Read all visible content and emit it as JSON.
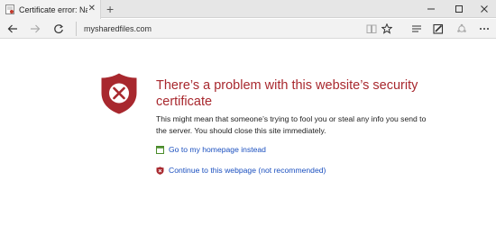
{
  "tab": {
    "title": "Certificate error: Naviga",
    "close_glyph": "✕",
    "new_tab_glyph": "+"
  },
  "window_controls": {
    "minimize_glyph": "—",
    "maximize_glyph": "☐",
    "close_glyph": "✕"
  },
  "address_bar": {
    "url": "mysharedfiles.com"
  },
  "toolbar_icons": [
    "back-icon",
    "forward-icon",
    "refresh-icon",
    "reading-view-icon",
    "favorites-star-icon",
    "hub-icon",
    "web-note-icon",
    "share-icon",
    "more-icon"
  ],
  "error_page": {
    "heading": "There’s a problem with this website’s security certificate",
    "description": "This might mean that someone’s trying to fool you or steal any info you send to the server. You should close this site immediately.",
    "homepage_link": "Go to my homepage instead",
    "continue_link": "Continue to this webpage (not recommended)"
  },
  "colors": {
    "error_red": "#a8282e",
    "link_blue": "#1a4fbf",
    "homepage_icon_green": "#4a8c2a"
  }
}
